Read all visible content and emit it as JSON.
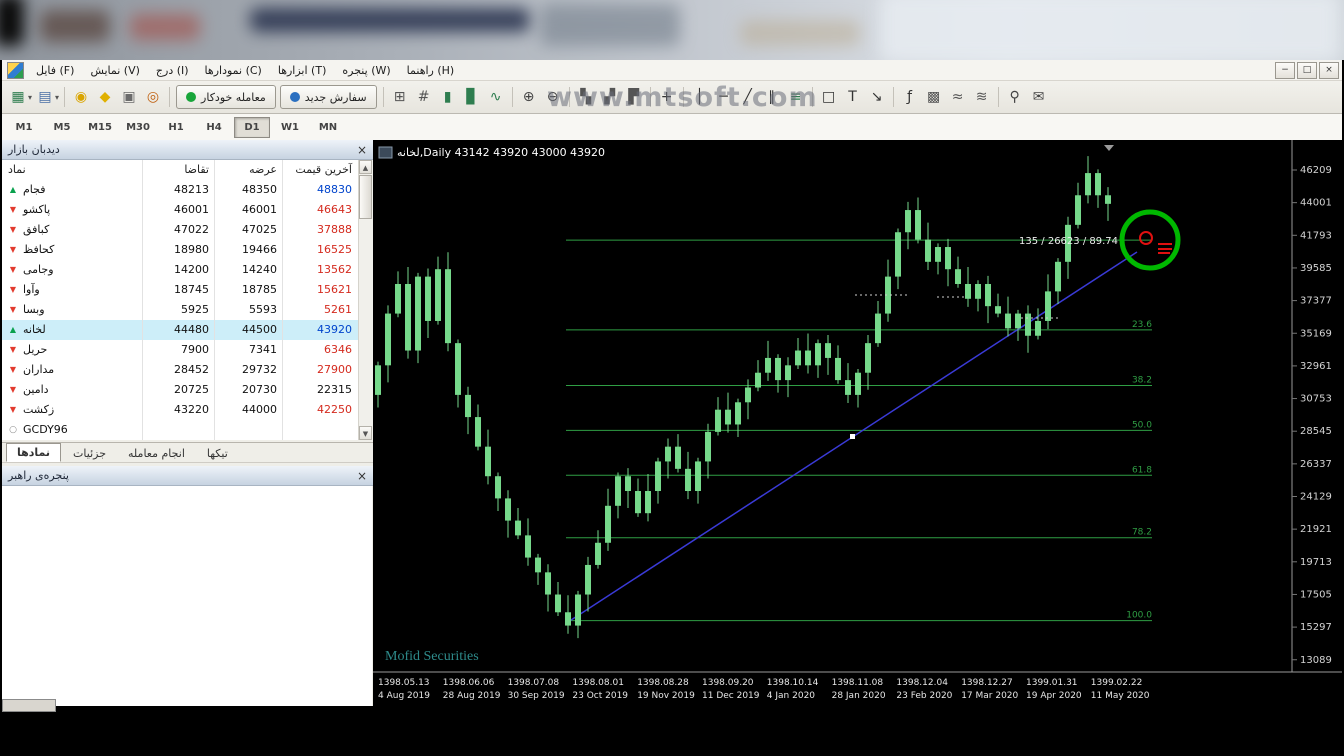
{
  "chrome": {
    "menu_items": [
      "فایل (F)",
      "نمایش (V)",
      "درج (I)",
      "نمودارها (C)",
      "ابزارها (T)",
      "پنجره (W)",
      "راهنما (H)"
    ],
    "window_buttons": [
      "−",
      "□",
      "×"
    ],
    "watermark": "www.mtsoft.com"
  },
  "toolbar": {
    "items": [
      {
        "t": "icon",
        "name": "new-chart",
        "g": "▦",
        "c": "#2e7d4f",
        "caret": true
      },
      {
        "t": "icon",
        "name": "chart-profiles",
        "g": "▤",
        "c": "#4a6fa5",
        "caret": true
      },
      {
        "t": "sep"
      },
      {
        "t": "icon",
        "name": "quotes-coin",
        "g": "◉",
        "c": "#d9a400"
      },
      {
        "t": "icon",
        "name": "gold-medal",
        "g": "◆",
        "c": "#e0b000"
      },
      {
        "t": "icon",
        "name": "print",
        "g": "▣",
        "c": "#6b6b6b"
      },
      {
        "t": "icon",
        "name": "target",
        "g": "◎",
        "c": "#c06010"
      },
      {
        "t": "sep"
      },
      {
        "t": "button",
        "name": "autotrading",
        "label": "معامله خودکار",
        "dot": "#18a53a"
      },
      {
        "t": "button",
        "name": "new-order",
        "label": "سفارش جدید",
        "dot": "#2a6fc0"
      },
      {
        "t": "sep"
      },
      {
        "t": "icon",
        "name": "grid",
        "g": "⊞",
        "c": "#555555"
      },
      {
        "t": "icon",
        "name": "digits",
        "g": "#",
        "c": "#555555"
      },
      {
        "t": "icon",
        "name": "chart-bars",
        "g": "▮",
        "c": "#2e7d4f"
      },
      {
        "t": "icon",
        "name": "chart-candles",
        "g": "▊",
        "c": "#2e7d4f"
      },
      {
        "t": "icon",
        "name": "chart-line",
        "g": "∿",
        "c": "#2e7d4f"
      },
      {
        "t": "sep"
      },
      {
        "t": "icon",
        "name": "zoom-in",
        "g": "⊕",
        "c": "#444444"
      },
      {
        "t": "icon",
        "name": "zoom-out",
        "g": "⊖",
        "c": "#444444"
      },
      {
        "t": "sep"
      },
      {
        "t": "icon",
        "name": "tile-windows",
        "g": "▚",
        "c": "#555555"
      },
      {
        "t": "icon",
        "name": "cascade-windows",
        "g": "▞",
        "c": "#555555"
      },
      {
        "t": "icon",
        "name": "arrange-windows",
        "g": "▛",
        "c": "#555555"
      },
      {
        "t": "sep"
      },
      {
        "t": "icon",
        "name": "crosshair",
        "g": "+",
        "c": "#333333"
      },
      {
        "t": "sep"
      },
      {
        "t": "icon",
        "name": "vertical-line",
        "g": "│",
        "c": "#333333"
      },
      {
        "t": "icon",
        "name": "horizontal-line",
        "g": "─",
        "c": "#333333"
      },
      {
        "t": "icon",
        "name": "trendline",
        "g": "╱",
        "c": "#333333"
      },
      {
        "t": "icon",
        "name": "channel",
        "g": "∥",
        "c": "#333333"
      },
      {
        "t": "icon",
        "name": "fibonacci",
        "g": "≡",
        "c": "#2e7d4f"
      },
      {
        "t": "sep"
      },
      {
        "t": "icon",
        "name": "shapes",
        "g": "□",
        "c": "#333333"
      },
      {
        "t": "icon",
        "name": "text-label",
        "g": "T",
        "c": "#333333"
      },
      {
        "t": "icon",
        "name": "arrow-object",
        "g": "↘",
        "c": "#333333"
      },
      {
        "t": "sep"
      },
      {
        "t": "icon",
        "name": "indicators",
        "g": "ƒ",
        "c": "#333333"
      },
      {
        "t": "icon",
        "name": "objects-grid",
        "g": "▩",
        "c": "#555555"
      },
      {
        "t": "icon",
        "name": "wave",
        "g": "≈",
        "c": "#555555"
      },
      {
        "t": "icon",
        "name": "hatch",
        "g": "≋",
        "c": "#555555"
      },
      {
        "t": "sep"
      },
      {
        "t": "icon",
        "name": "search",
        "g": "⚲",
        "c": "#444444"
      },
      {
        "t": "icon",
        "name": "chat",
        "g": "✉",
        "c": "#444444"
      }
    ]
  },
  "timeframes": {
    "items": [
      "M1",
      "M5",
      "M15",
      "M30",
      "H1",
      "H4",
      "D1",
      "W1",
      "MN"
    ],
    "active": "D1"
  },
  "market_watch": {
    "title": "دیدبان بازار",
    "close": "×",
    "columns": {
      "symbol": "نماد",
      "bid": "تقاضا",
      "ask": "عرضه",
      "last": "آخرین قیمت"
    },
    "rows": [
      {
        "symbol": "فجام",
        "bid": "48213",
        "ask": "48350",
        "last": "48830",
        "icon": "up",
        "tone": "blue",
        "selected": false
      },
      {
        "symbol": "پاکشو",
        "bid": "46001",
        "ask": "46001",
        "last": "46643",
        "icon": "down",
        "tone": "red",
        "selected": false
      },
      {
        "symbol": "کبافق",
        "bid": "47022",
        "ask": "47025",
        "last": "37888",
        "icon": "down",
        "tone": "red",
        "selected": false
      },
      {
        "symbol": "کحافظ",
        "bid": "18980",
        "ask": "19466",
        "last": "16525",
        "icon": "down",
        "tone": "red",
        "selected": false
      },
      {
        "symbol": "وجامی",
        "bid": "14200",
        "ask": "14240",
        "last": "13562",
        "icon": "down",
        "tone": "red",
        "selected": false
      },
      {
        "symbol": "وآوا",
        "bid": "18745",
        "ask": "18785",
        "last": "15621",
        "icon": "down",
        "tone": "red",
        "selected": false
      },
      {
        "symbol": "وبسا",
        "bid": "5925",
        "ask": "5593",
        "last": "5261",
        "icon": "down",
        "tone": "red",
        "selected": false
      },
      {
        "symbol": "لخانه",
        "bid": "44480",
        "ask": "44500",
        "last": "43920",
        "icon": "up",
        "tone": "blue",
        "selected": true
      },
      {
        "symbol": "حریل",
        "bid": "7900",
        "ask": "7341",
        "last": "6346",
        "icon": "down",
        "tone": "red",
        "selected": false
      },
      {
        "symbol": "مداران",
        "bid": "28452",
        "ask": "29732",
        "last": "27900",
        "icon": "down",
        "tone": "red",
        "selected": false
      },
      {
        "symbol": "دامین",
        "bid": "20725",
        "ask": "20730",
        "last": "22315",
        "icon": "down",
        "tone": "black",
        "selected": false
      },
      {
        "symbol": "زکشت",
        "bid": "43220",
        "ask": "44000",
        "last": "42250",
        "icon": "down",
        "tone": "red",
        "selected": false
      },
      {
        "symbol": "GCDY96",
        "bid": "",
        "ask": "",
        "last": "",
        "icon": "circle",
        "tone": "black",
        "selected": false
      }
    ],
    "tabs": [
      {
        "label": "نمادها",
        "active": true
      },
      {
        "label": "جزئیات",
        "active": false
      },
      {
        "label": "انجام معامله",
        "active": false
      },
      {
        "label": "تیکها",
        "active": false
      }
    ]
  },
  "navigator": {
    "title": "پنجره‌ی راهبر",
    "close": "×"
  },
  "chart_data": {
    "type": "candlestick",
    "symbol_title": "لخانه,Daily  43142 43920 43000 43920",
    "info_label": "135 / 26623 / 89.74",
    "watermark": "Mofid Securities",
    "price_axis": [
      46209,
      44001,
      41793,
      39585,
      37377,
      35169,
      32961,
      30753,
      28545,
      26337,
      24129,
      21921,
      19713,
      17505,
      15297,
      13089
    ],
    "x_axis": [
      {
        "jalali": "1398.05.13",
        "greg": "4 Aug 2019"
      },
      {
        "jalali": "1398.06.06",
        "greg": "28 Aug 2019"
      },
      {
        "jalali": "1398.07.08",
        "greg": "30 Sep 2019"
      },
      {
        "jalali": "1398.08.01",
        "greg": "23 Oct 2019"
      },
      {
        "jalali": "1398.08.28",
        "greg": "19 Nov 2019"
      },
      {
        "jalali": "1398.09.20",
        "greg": "11 Dec 2019"
      },
      {
        "jalali": "1398.10.14",
        "greg": "4 Jan 2020"
      },
      {
        "jalali": "1398.11.08",
        "greg": "28 Jan 2020"
      },
      {
        "jalali": "1398.12.04",
        "greg": "23 Feb 2020"
      },
      {
        "jalali": "1398.12.27",
        "greg": "17 Mar 2020"
      },
      {
        "jalali": "1399.01.31",
        "greg": "19 Apr 2020"
      },
      {
        "jalali": "1399.02.22",
        "greg": "11 May 2020"
      }
    ],
    "fib_levels": [
      {
        "label": "",
        "price": 41470
      },
      {
        "label": "23.6",
        "price": 35396
      },
      {
        "label": "38.2",
        "price": 31638
      },
      {
        "label": "50.0",
        "price": 28601
      },
      {
        "label": "61.8",
        "price": 25563
      },
      {
        "label": "78.2",
        "price": 21342
      },
      {
        "label": "100.0",
        "price": 15731
      }
    ],
    "closes": [
      33000,
      36500,
      38500,
      34000,
      39000,
      36000,
      39500,
      34500,
      31000,
      29500,
      27500,
      25500,
      24000,
      22500,
      21500,
      20000,
      19000,
      17500,
      16300,
      15400,
      17500,
      19500,
      21000,
      23500,
      25500,
      24500,
      23000,
      24500,
      26500,
      27500,
      26000,
      24500,
      26500,
      28500,
      30000,
      29000,
      30500,
      31500,
      32500,
      33500,
      32000,
      33000,
      34000,
      33000,
      34500,
      33500,
      32000,
      31000,
      32500,
      34500,
      36500,
      39000,
      42000,
      43500,
      41500,
      40000,
      41000,
      39500,
      38500,
      37500,
      38500,
      37000,
      36500,
      35500,
      36500,
      35000,
      36000,
      38000,
      40000,
      42500,
      44500,
      46000,
      44500,
      43920
    ],
    "colors": {
      "candle": "#76d98b",
      "fib": "#2f9e44",
      "trend": "#3a3ad6",
      "annotation": "#00b800",
      "marker": "#e01010"
    }
  }
}
